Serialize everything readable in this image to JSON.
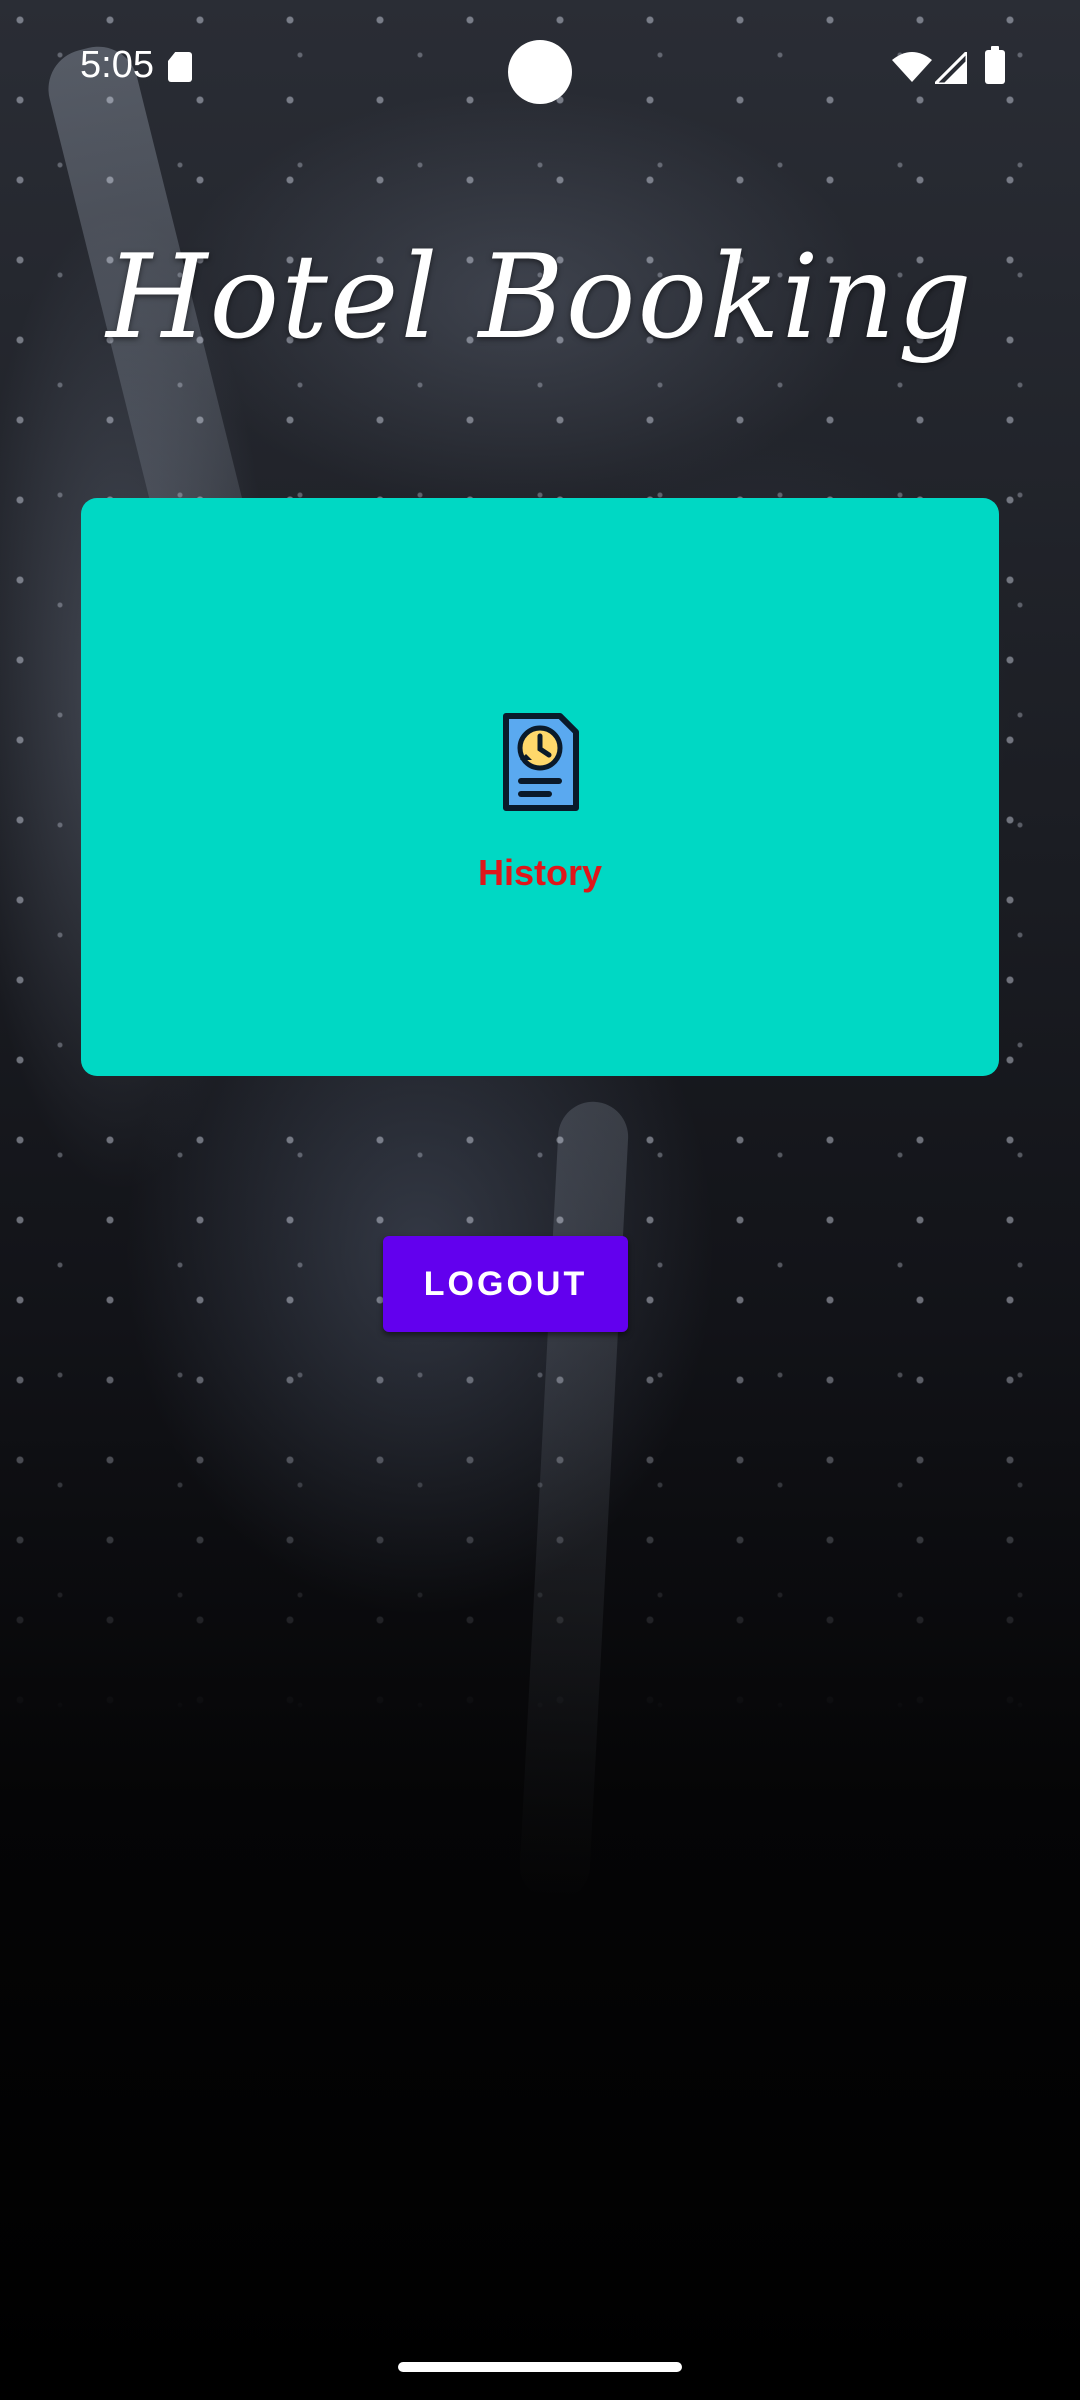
{
  "status_bar": {
    "time": "5:05",
    "icons": [
      "sd-card-icon",
      "wifi-icon",
      "signal-icon",
      "battery-icon"
    ]
  },
  "app": {
    "title": "Hotel Booking"
  },
  "menu": {
    "history": {
      "label": "History",
      "icon": "history-document-icon",
      "background_color": "#00d8c4",
      "label_color": "#e0161a"
    }
  },
  "actions": {
    "logout_label": "LOGOUT",
    "logout_color": "#6200ee"
  }
}
